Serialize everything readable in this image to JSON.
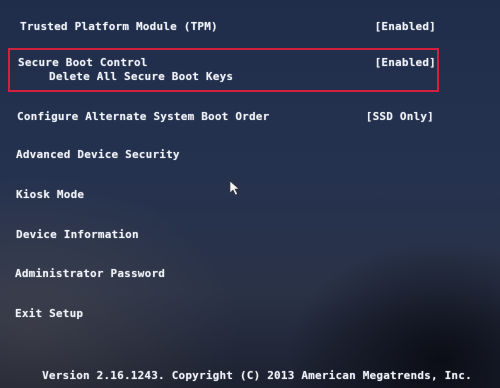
{
  "menu": {
    "items": [
      {
        "label": "Trusted Platform Module (TPM)",
        "value": "[Enabled]"
      },
      {
        "label": "Secure Boot Control",
        "value": "[Enabled]",
        "sub_label": "Delete All Secure Boot Keys"
      },
      {
        "label": "Configure Alternate System Boot Order",
        "value": "[SSD Only]"
      },
      {
        "label": "Advanced Device Security"
      },
      {
        "label": "Kiosk Mode"
      },
      {
        "label": "Device Information"
      },
      {
        "label": "Administrator Password"
      },
      {
        "label": "Exit Setup"
      }
    ]
  },
  "footer": {
    "text": "Version 2.16.1243. Copyright (C) 2013 American Megatrends, Inc."
  },
  "colors": {
    "background": "#1f2d4b",
    "text": "#eef1f7",
    "highlight_border": "#d3203f"
  },
  "icons": {
    "pointer": "mouse-pointer-icon"
  }
}
